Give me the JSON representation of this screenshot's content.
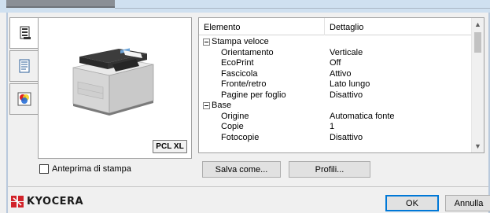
{
  "side_tabs": [
    {
      "icon": "settings-list-icon"
    },
    {
      "icon": "document-icon"
    },
    {
      "icon": "color-icon"
    }
  ],
  "preview": {
    "badge": "PCL XL"
  },
  "details": {
    "headers": {
      "element": "Elemento",
      "detail": "Dettaglio"
    },
    "rows": [
      {
        "type": "group",
        "label": "Stampa veloce",
        "value": ""
      },
      {
        "type": "item",
        "label": "Orientamento",
        "value": "Verticale"
      },
      {
        "type": "item",
        "label": "EcoPrint",
        "value": "Off"
      },
      {
        "type": "item",
        "label": "Fascicola",
        "value": "Attivo"
      },
      {
        "type": "item",
        "label": "Fronte/retro",
        "value": "Lato lungo"
      },
      {
        "type": "item",
        "label": "Pagine per foglio",
        "value": "Disattivo"
      },
      {
        "type": "group",
        "label": "Base",
        "value": ""
      },
      {
        "type": "item",
        "label": "Origine",
        "value": "Automatica fonte"
      },
      {
        "type": "item",
        "label": "Copie",
        "value": "1"
      },
      {
        "type": "item",
        "label": "Fotocopie",
        "value": "Disattivo"
      }
    ]
  },
  "print_preview_checkbox": {
    "label": "Anteprima di stampa",
    "checked": false
  },
  "buttons": {
    "save_as": "Salva come...",
    "profiles": "Profili...",
    "ok": "OK",
    "cancel": "Annulla"
  },
  "brand": {
    "name": "KYOCERA",
    "color": "#d2232a"
  }
}
